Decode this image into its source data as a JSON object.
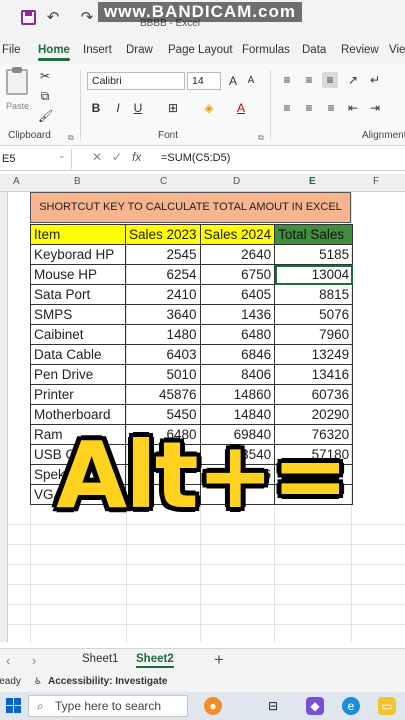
{
  "window": {
    "title": "BBBB - Excel",
    "watermark": "www.BANDICAM.com"
  },
  "menu": [
    "File",
    "Home",
    "Insert",
    "Draw",
    "Page Layout",
    "Formulas",
    "Data",
    "Review",
    "View"
  ],
  "ribbon": {
    "paste_label": "Paste",
    "font_name": "Calibri",
    "font_size": "14",
    "groups": {
      "clipboard": "Clipboard",
      "font": "Font",
      "alignment": "Alignment"
    }
  },
  "formula_bar": {
    "name_box": "E5",
    "formula": "=SUM(C5:D5)"
  },
  "columns": [
    "A",
    "B",
    "C",
    "D",
    "E",
    "F"
  ],
  "sheet": {
    "title": "SHORTCUT KEY TO CALCULATE TOTAL AMOUT IN EXCEL",
    "headers": [
      "Item",
      "Sales 2023",
      "Sales 2024",
      "Total Sales"
    ],
    "rows": [
      [
        "Keyborad HP",
        "2545",
        "2640",
        "5185"
      ],
      [
        "Mouse HP",
        "6254",
        "6750",
        "13004"
      ],
      [
        "Sata Port",
        "2410",
        "6405",
        "8815"
      ],
      [
        "SMPS",
        "3640",
        "1436",
        "5076"
      ],
      [
        "Caibinet",
        "1480",
        "6480",
        "7960"
      ],
      [
        "Data Cable",
        "6403",
        "6846",
        "13249"
      ],
      [
        "Pen Drive",
        "5010",
        "8406",
        "13416"
      ],
      [
        "Printer",
        "45876",
        "14860",
        "60736"
      ],
      [
        "Motherboard",
        "5450",
        "14840",
        "20290"
      ],
      [
        "Ram",
        "6480",
        "69840",
        "76320"
      ],
      [
        "USB Cable",
        "",
        "23540",
        "57180"
      ],
      [
        "Speker",
        "",
        "406",
        ""
      ],
      [
        "VGA Cable",
        "",
        "",
        ""
      ]
    ]
  },
  "overlay_text": "Alt+=",
  "tabs": [
    "Sheet1",
    "Sheet2"
  ],
  "status": {
    "ready": "Ready",
    "accessibility": "Accessibility: Investigate"
  },
  "taskbar": {
    "search_placeholder": "Type here to search"
  },
  "colors": {
    "accent": "#1e6b3c",
    "header_yellow": "#ffff00",
    "total_green": "#3f8f3f",
    "title_orange": "#f6b58e",
    "overlay": "#ffd21f"
  }
}
